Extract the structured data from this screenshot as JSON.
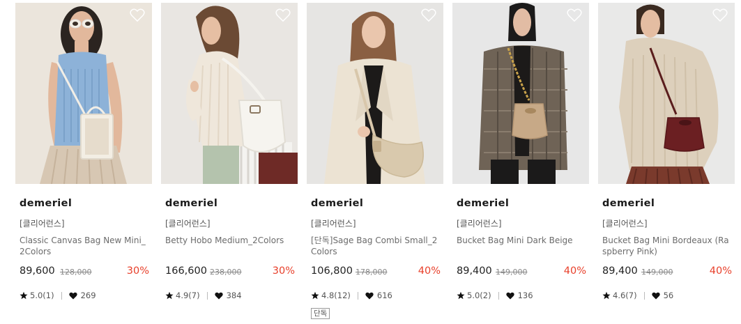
{
  "products": [
    {
      "brand": "demeriel",
      "tag": "[클리어런스]",
      "name": "Classic Canvas Bag New Mini_2Colors",
      "price": "89,600",
      "original_price": "128,000",
      "discount": "30%",
      "rating": "5.0(1)",
      "likes": "269",
      "badge": "",
      "wishlist_icon": "heart-outline-icon",
      "image_alt": "model with sleeveless blue knit top and cream canvas mini bag"
    },
    {
      "brand": "demeriel",
      "tag": "[클리어런스]",
      "name": "Betty Hobo Medium_2Colors",
      "price": "166,600",
      "original_price": "238,000",
      "discount": "30%",
      "rating": "4.9(7)",
      "likes": "384",
      "badge": "",
      "wishlist_icon": "heart-outline-icon",
      "image_alt": "model in ribbed cream cardigan with white hobo bag"
    },
    {
      "brand": "demeriel",
      "tag": "[클리어런스]",
      "name": "[단독]Sage Bag Combi Small_2Colors",
      "price": "106,800",
      "original_price": "178,000",
      "discount": "40%",
      "rating": "4.8(12)",
      "likes": "616",
      "badge": "단독",
      "wishlist_icon": "heart-outline-icon",
      "image_alt": "model in cream blazer with beige crossbody sage bag"
    },
    {
      "brand": "demeriel",
      "tag": "[클리어런스]",
      "name": "Bucket Bag Mini Dark Beige",
      "price": "89,400",
      "original_price": "149,000",
      "discount": "40%",
      "rating": "5.0(2)",
      "likes": "136",
      "badge": "",
      "wishlist_icon": "heart-outline-icon",
      "image_alt": "model in check blazer with dark beige mini bucket bag"
    },
    {
      "brand": "demeriel",
      "tag": "[클리어런스]",
      "name": "Bucket Bag Mini Bordeaux (Raspberry Pink)",
      "price": "89,400",
      "original_price": "149,000",
      "discount": "40%",
      "rating": "4.6(7)",
      "likes": "56",
      "badge": "",
      "wishlist_icon": "heart-outline-icon",
      "image_alt": "model in oatmeal knit sweater with bordeaux mini bucket bag"
    }
  ],
  "colors": {
    "discount": "#e8402b",
    "brand_text": "#1a1a1a",
    "meta_text": "#555555"
  },
  "icons": {
    "rating": "star-icon",
    "likes": "heart-filled-icon"
  }
}
